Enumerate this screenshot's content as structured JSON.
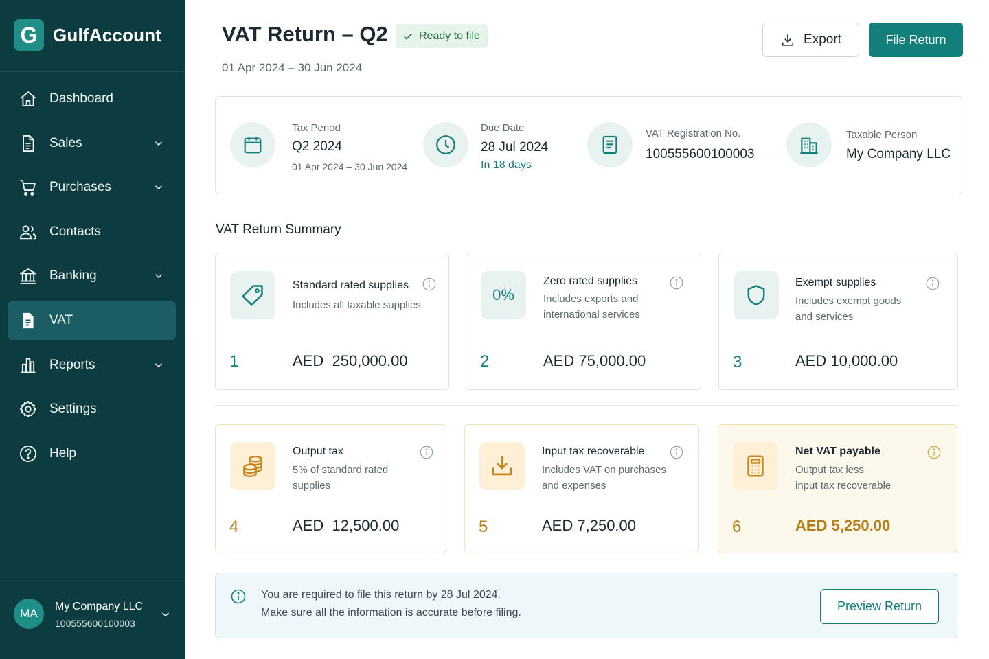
{
  "app": {
    "brand_initial": "G",
    "brand_name": "GulfAccount"
  },
  "sidebar": {
    "items": [
      {
        "label": "Dashboard",
        "icon": "home-icon",
        "has_chevron": false
      },
      {
        "label": "Sales",
        "icon": "document-icon",
        "has_chevron": true
      },
      {
        "label": "Purchases",
        "icon": "cart-icon",
        "has_chevron": true
      },
      {
        "label": "Contacts",
        "icon": "users-icon",
        "has_chevron": false
      },
      {
        "label": "Banking",
        "icon": "bank-icon",
        "has_chevron": true
      },
      {
        "label": "VAT",
        "icon": "vat-file-icon",
        "has_chevron": false,
        "active": true
      },
      {
        "label": "Reports",
        "icon": "bar-chart-icon",
        "has_chevron": true
      },
      {
        "label": "Settings",
        "icon": "gear-icon",
        "has_chevron": false
      },
      {
        "label": "Help",
        "icon": "help-icon",
        "has_chevron": false
      }
    ],
    "user": {
      "initials": "MA",
      "name": "My Company LLC",
      "trn": "100555600100003"
    }
  },
  "header": {
    "title": "VAT Return – Q2",
    "status": "Ready to file",
    "subtitle": "01 Apr 2024 – 30 Jun 2024",
    "export_label": "Export",
    "file_label": "File Return"
  },
  "info": {
    "tax_period": {
      "label": "Tax Period",
      "value": "Q2 2024",
      "sub": "01 Apr 2024 – 30 Jun 2024"
    },
    "due_date": {
      "label": "Due Date",
      "value": "28 Jul 2024",
      "sub": "In 18 days"
    },
    "vat_reg": {
      "label": "VAT Registration No.",
      "value": "100555600100003"
    },
    "taxable_person": {
      "label": "Taxable Person",
      "value": "My Company LLC"
    }
  },
  "summary": {
    "title": "VAT Return Summary",
    "cards": [
      {
        "num": "1",
        "title": "Standard rated supplies",
        "desc": [
          "Includes all taxable supplies"
        ],
        "currency": "AED",
        "amount": "250,000.00"
      },
      {
        "num": "2",
        "icon_text": "0%",
        "title": "Zero rated supplies",
        "desc": [
          "Includes exports and",
          "international services"
        ],
        "currency": "AED",
        "amount": "75,000.00"
      },
      {
        "num": "3",
        "title": "Exempt supplies",
        "desc": [
          "Includes exempt goods",
          "and services"
        ],
        "currency": "AED",
        "amount": "10,000.00"
      },
      {
        "num": "4",
        "title": "Output tax",
        "desc": [
          "5% of standard rated",
          "supplies"
        ],
        "currency": "AED",
        "amount": "12,500.00"
      },
      {
        "num": "5",
        "title": "Input tax recoverable",
        "desc": [
          "Includes VAT on purchases",
          "and expenses"
        ],
        "currency": "AED",
        "amount": "7,250.00"
      },
      {
        "num": "6",
        "title": "Net VAT payable",
        "desc": [
          "Output tax less",
          "input tax recoverable"
        ],
        "currency": "AED",
        "amount": "5,250.00"
      }
    ]
  },
  "notice": {
    "line1": "You are required to file this return by 28 Jul 2024.",
    "line2": "Make sure all the information is accurate before filing.",
    "button": "Preview Return"
  },
  "colors": {
    "sidebar_bg": "#0c3b40",
    "accent": "#137f7a",
    "amber": "#b57e16",
    "status_bg": "#e6f4ea"
  }
}
